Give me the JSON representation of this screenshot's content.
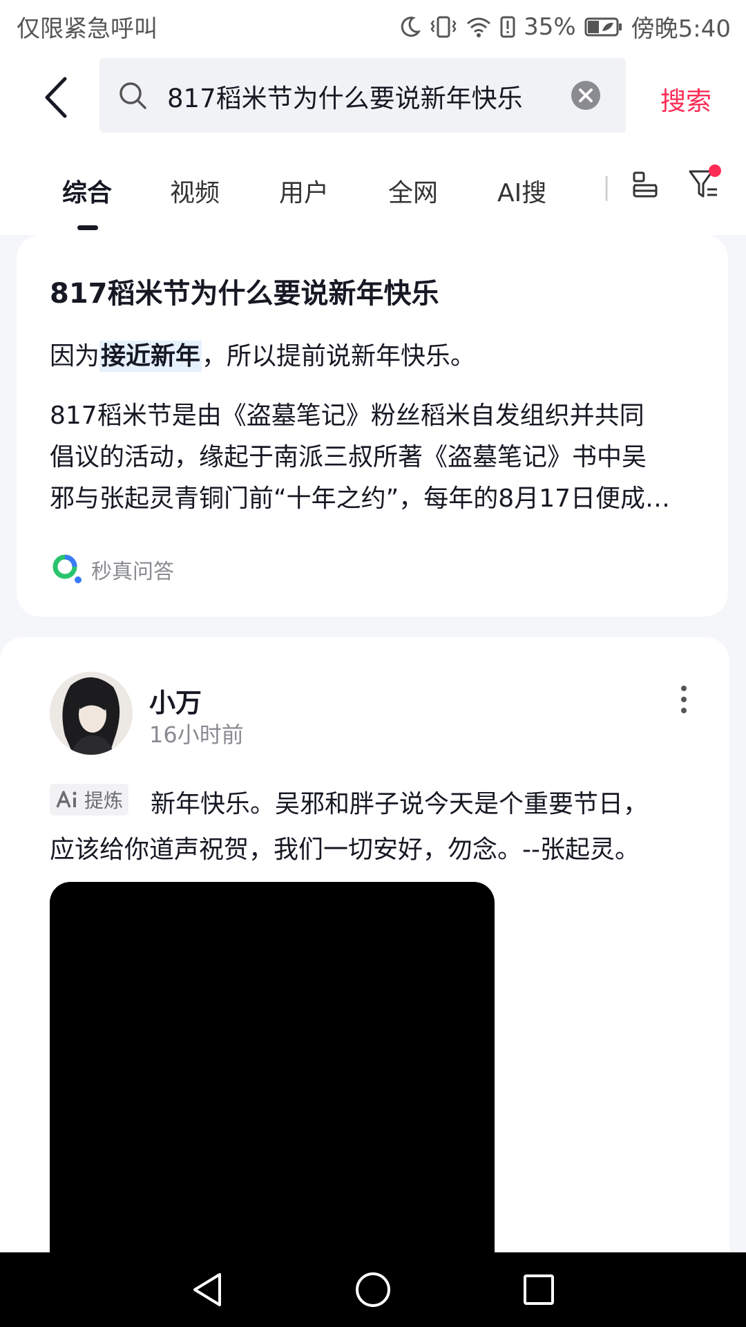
{
  "status_bar": {
    "carrier_text": "仅限紧急呼叫",
    "battery_percent": "35%",
    "time": "傍晚5:40"
  },
  "search": {
    "query": "817稻米节为什么要说新年快乐",
    "submit_label": "搜索"
  },
  "tabs": [
    {
      "label": "综合",
      "active": true
    },
    {
      "label": "视频",
      "active": false
    },
    {
      "label": "用户",
      "active": false
    },
    {
      "label": "全网",
      "active": false
    },
    {
      "label": "AI搜",
      "active": false
    }
  ],
  "answer_card": {
    "title": "817稻米节为什么要说新年快乐",
    "short_prefix": "因为",
    "short_highlight": "接近新年",
    "short_suffix": "，所以提前说新年快乐。",
    "body_lines": [
      "817稻米节是由《盗墓笔记》粉丝稻米自发组织并共同",
      "倡议的活动，缘起于南派三叔所著《盗墓笔记》书中吴",
      "邪与张起灵青铜门前“十年之约”，每年的8月17日便成…"
    ],
    "source_name": "秒真问答"
  },
  "post": {
    "author": "小万",
    "time": "16小时前",
    "ai_badge_label": "提炼",
    "text_line_1": "新年快乐。吴邪和胖子说今天是个重要节日，",
    "text_line_2": "应该给你道声祝贺，我们一切安好，勿念。--张起灵。"
  },
  "colors": {
    "accent": "#fe2c55",
    "highlight_bg": "#e6f1fd",
    "text_primary": "#161823",
    "text_secondary": "#8a8b91"
  }
}
